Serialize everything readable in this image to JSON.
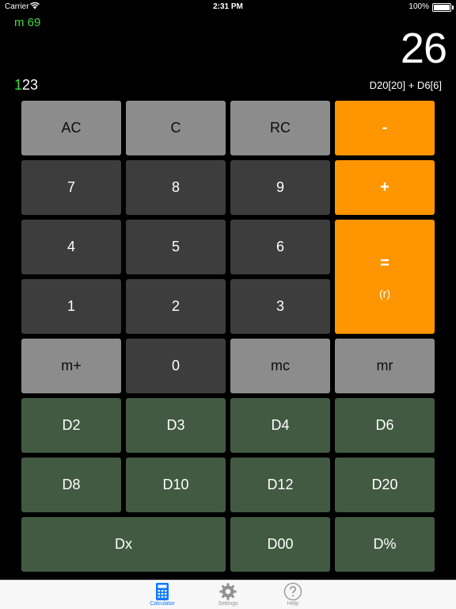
{
  "status_bar": {
    "carrier": "Carrier",
    "time": "2:31 PM",
    "battery": "100%"
  },
  "display": {
    "memory": "m 69",
    "result": "26",
    "roll_digit_highlight": "1",
    "roll_digits_rest": "23",
    "expression": "D20[20] + D6[6]"
  },
  "keys": {
    "ac": "AC",
    "c": "C",
    "rc": "RC",
    "minus": "-",
    "plus": "+",
    "seven": "7",
    "eight": "8",
    "nine": "9",
    "four": "4",
    "five": "5",
    "six": "6",
    "one": "1",
    "two": "2",
    "three": "3",
    "equals": "=",
    "equals_sub": "(r)",
    "mplus": "m+",
    "zero": "0",
    "mc": "mc",
    "mr": "mr",
    "d2": "D2",
    "d3": "D3",
    "d4": "D4",
    "d6": "D6",
    "d8": "D8",
    "d10": "D10",
    "d12": "D12",
    "d20": "D20",
    "dx": "Dx",
    "d00": "D00",
    "dpercent": "D%"
  },
  "tabs": [
    {
      "label": "Calculator",
      "icon": "calculator-icon",
      "active": true
    },
    {
      "label": "Settings",
      "icon": "gear-icon",
      "active": false
    },
    {
      "label": "Help",
      "icon": "help-icon",
      "active": false
    }
  ],
  "colors": {
    "accent_green": "#3ddc3d",
    "operator_orange": "#ff9500",
    "dice_green": "#425a42",
    "tab_active": "#0a7aff"
  }
}
